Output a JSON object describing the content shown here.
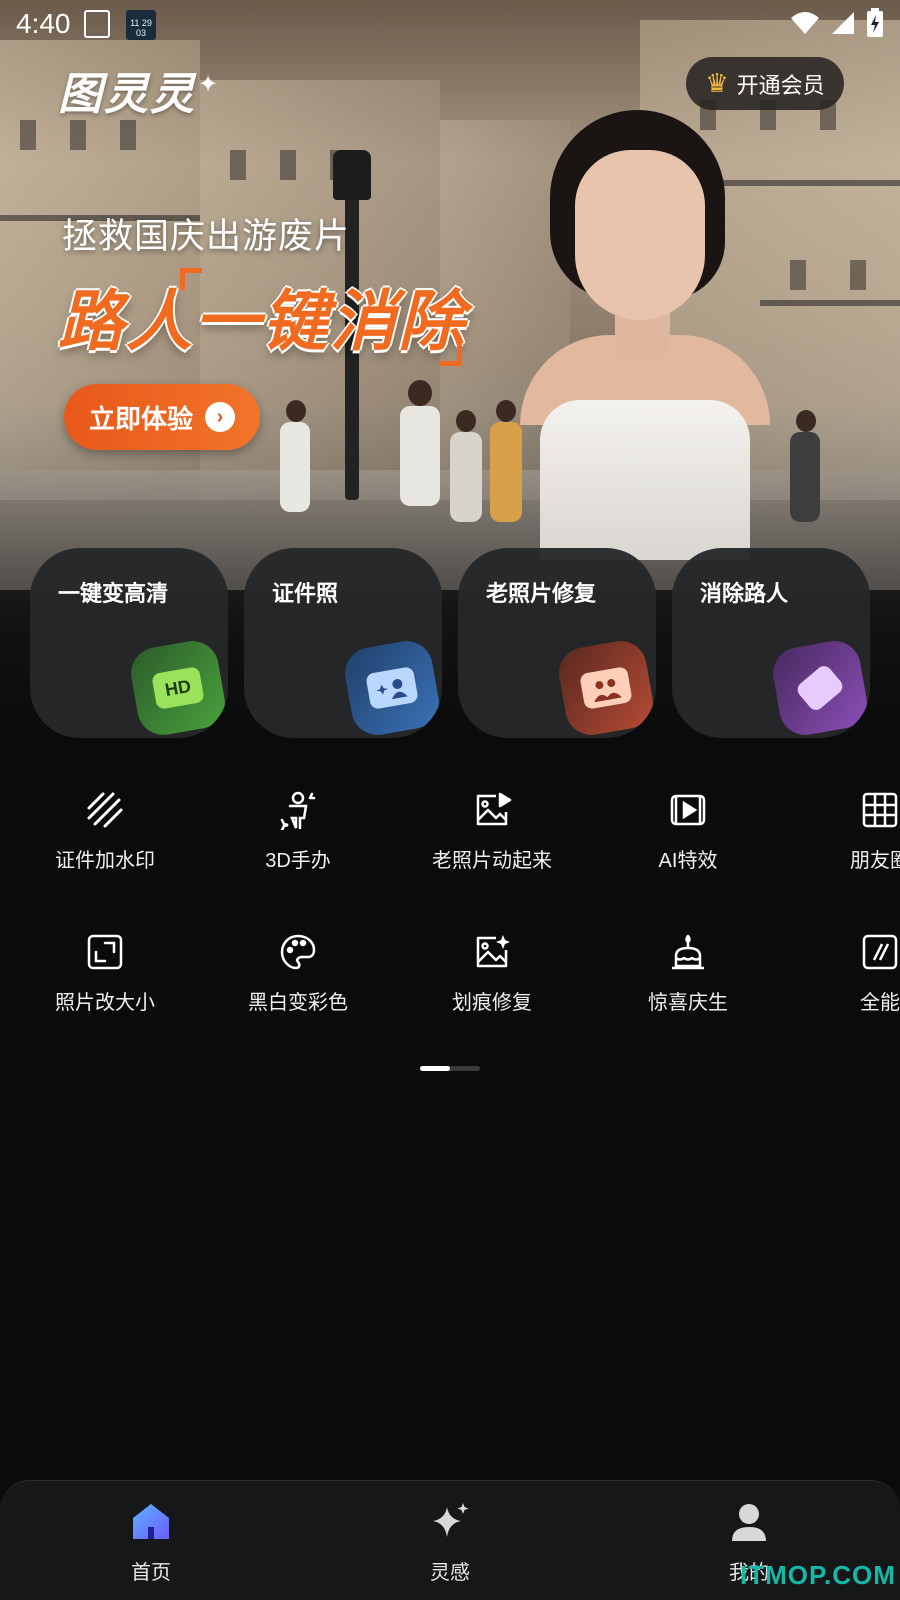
{
  "status_bar": {
    "time": "4:40",
    "app_icon_text": "11 29 03"
  },
  "hero": {
    "logo": "图灵灵",
    "vip_button": "开通会员",
    "subtitle": "拯救国庆出游废片",
    "title": "路人一键消除",
    "cta": "立即体验"
  },
  "cards": [
    {
      "title": "一键变高清",
      "badge_text": "HD",
      "badge_icon": "hd-icon"
    },
    {
      "title": "证件照",
      "badge_icon": "id-card-icon"
    },
    {
      "title": "老照片修复",
      "badge_icon": "photo-restore-icon"
    },
    {
      "title": "消除路人",
      "badge_icon": "eraser-icon"
    }
  ],
  "tools": {
    "row1": [
      {
        "label": "证件加水印",
        "icon": "watermark-icon"
      },
      {
        "label": "3D手办",
        "icon": "figure-icon"
      },
      {
        "label": "老照片动起来",
        "icon": "animate-photo-icon"
      },
      {
        "label": "AI特效",
        "icon": "video-effect-icon"
      },
      {
        "label": "朋友圈",
        "icon": "grid-icon"
      }
    ],
    "row2": [
      {
        "label": "照片改大小",
        "icon": "resize-icon"
      },
      {
        "label": "黑白变彩色",
        "icon": "palette-icon"
      },
      {
        "label": "划痕修复",
        "icon": "scratch-repair-icon"
      },
      {
        "label": "惊喜庆生",
        "icon": "cake-icon"
      },
      {
        "label": "全能",
        "icon": "all-in-one-icon"
      }
    ]
  },
  "pager": {
    "pages": 2,
    "current": 1
  },
  "bottom_nav": [
    {
      "label": "首页",
      "icon": "home-icon",
      "active": true
    },
    {
      "label": "灵感",
      "icon": "sparkle-icon",
      "active": false
    },
    {
      "label": "我的",
      "icon": "profile-icon",
      "active": false
    }
  ],
  "watermark": "ITMOP.COM",
  "colors": {
    "accent": "#f06a1f",
    "background": "#0b0b0c",
    "crown": "#f6b93b"
  }
}
